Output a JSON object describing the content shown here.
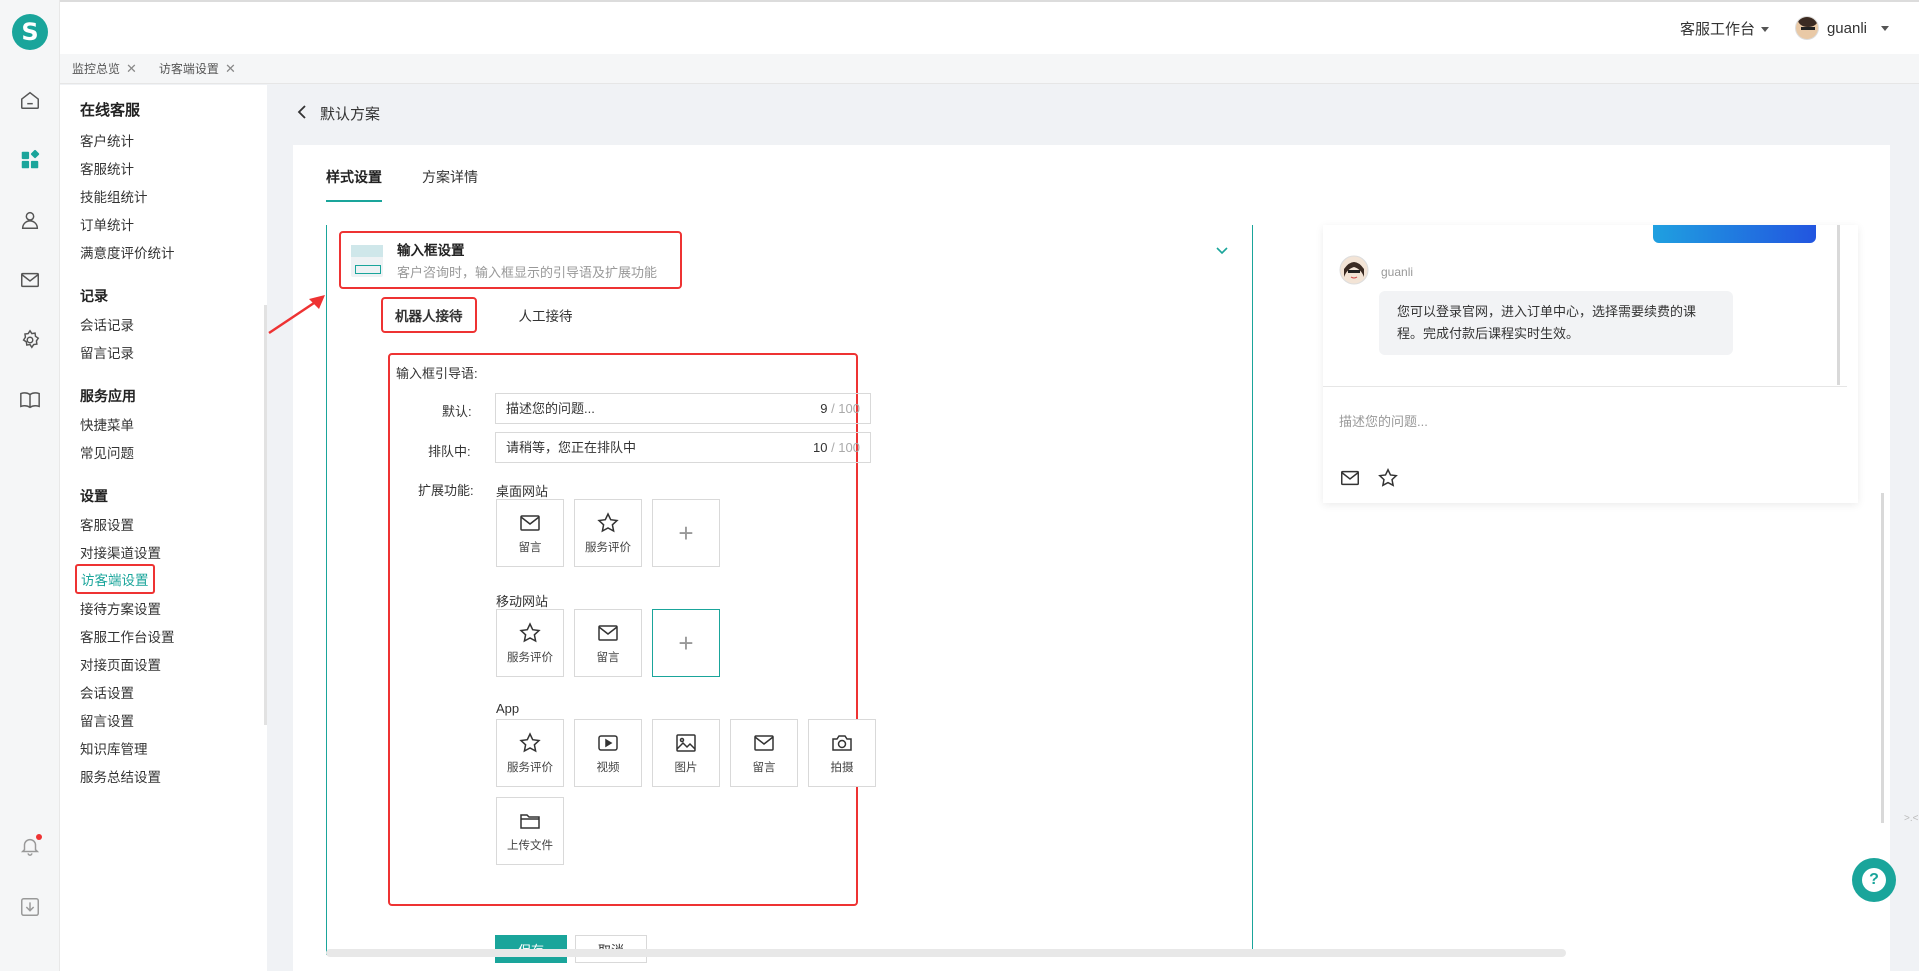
{
  "app": {
    "logo_letter": "S",
    "accent": "#1aa59b",
    "alert": "#e33"
  },
  "header": {
    "workbench": "客服工作台",
    "user": "guanli"
  },
  "tabs": [
    {
      "label": "监控总览"
    },
    {
      "label": "访客端设置"
    }
  ],
  "sidenav": {
    "title": "在线客服",
    "groups": [
      {
        "items": [
          "客户统计",
          "客服统计",
          "技能组统计",
          "订单统计",
          "满意度评价统计"
        ]
      },
      {
        "label": "记录",
        "items": [
          "会话记录",
          "留言记录"
        ]
      },
      {
        "label": "服务应用",
        "items": [
          "快捷菜单",
          "常见问题"
        ]
      },
      {
        "label": "设置",
        "items": [
          "客服设置",
          "对接渠道设置",
          "访客端设置",
          "接待方案设置",
          "客服工作台设置",
          "对接页面设置",
          "会话设置",
          "留言设置",
          "知识库管理",
          "服务总结设置"
        ]
      }
    ],
    "active_item": "访客端设置"
  },
  "page": {
    "title": "默认方案",
    "tabs": [
      "样式设置",
      "方案详情"
    ],
    "active_tab": "样式设置"
  },
  "section": {
    "title": "输入框设置",
    "desc": "客户咨询时，输入框显示的引导语及扩展功能",
    "subtabs": [
      "机器人接待",
      "人工接待"
    ],
    "active_subtab": "机器人接待"
  },
  "form": {
    "guide_label": "输入框引导语:",
    "default_label": "默认:",
    "default_value": "描述您的问题...",
    "default_count": "9",
    "default_max": " / 100",
    "queue_label": "排队中:",
    "queue_value": "请稍等，您正在排队中",
    "queue_count": "10",
    "queue_max": " / 100",
    "ext_label": "扩展功能:",
    "desktop_label": "桌面网站",
    "desktop_tiles": [
      {
        "label": "留言",
        "icon": "mail-icon"
      },
      {
        "label": "服务评价",
        "icon": "star-icon"
      }
    ],
    "mobile_label": "移动网站",
    "mobile_tiles": [
      {
        "label": "服务评价",
        "icon": "star-icon"
      },
      {
        "label": "留言",
        "icon": "mail-icon"
      }
    ],
    "app_label": "App",
    "app_tiles": [
      {
        "label": "服务评价",
        "icon": "star-icon"
      },
      {
        "label": "视频",
        "icon": "video-icon"
      },
      {
        "label": "图片",
        "icon": "image-icon"
      },
      {
        "label": "留言",
        "icon": "mail-icon"
      },
      {
        "label": "拍摄",
        "icon": "camera-icon"
      },
      {
        "label": "上传文件",
        "icon": "folder-icon"
      }
    ],
    "plus": "+",
    "save": "保存",
    "cancel": "取消"
  },
  "preview": {
    "name": "guanli",
    "message": "您可以登录官网，进入订单中心，选择需要续费的课程。完成付款后课程实时生效。",
    "placeholder": "描述您的问题..."
  },
  "misc": {
    "edge_hint": ">.<",
    "help_glyph": "?"
  }
}
